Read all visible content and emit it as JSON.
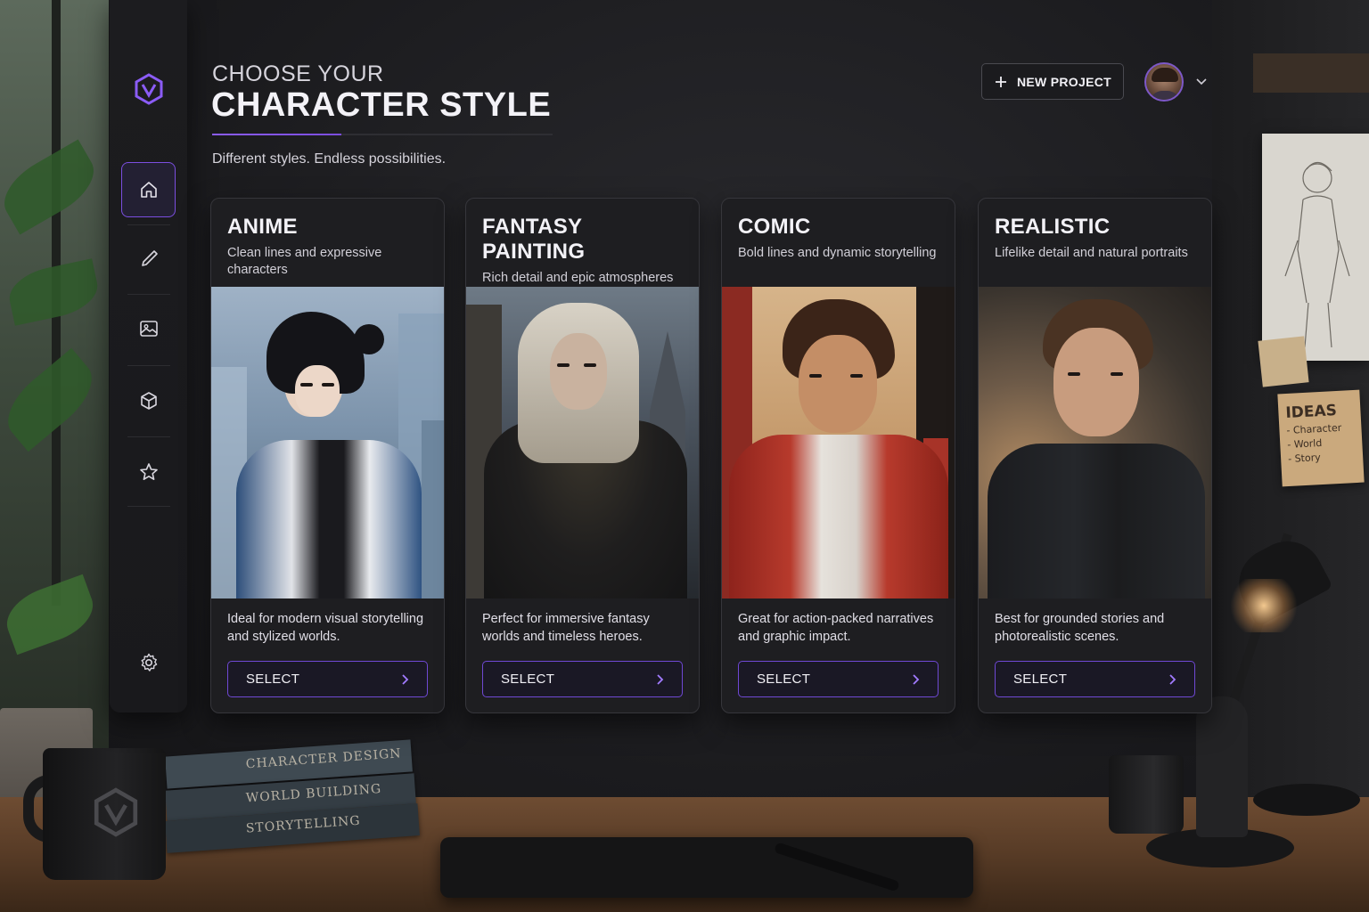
{
  "header": {
    "eyebrow": "CHOOSE YOUR",
    "title": "CHARACTER STYLE",
    "subtitle": "Different styles. Endless possibilities.",
    "new_project_label": "NEW PROJECT"
  },
  "sidebar": {
    "items": [
      {
        "name": "home",
        "icon": "home-icon",
        "active": true
      },
      {
        "name": "brush",
        "icon": "brush-icon",
        "active": false
      },
      {
        "name": "gallery",
        "icon": "image-icon",
        "active": false
      },
      {
        "name": "models",
        "icon": "cube-icon",
        "active": false
      },
      {
        "name": "favorites",
        "icon": "star-icon",
        "active": false
      }
    ],
    "settings_icon": "gear-icon"
  },
  "cards": [
    {
      "title": "ANIME",
      "tagline": "Clean lines and expressive characters",
      "description": "Ideal for modern visual storytelling and stylized worlds.",
      "button": "SELECT"
    },
    {
      "title": "FANTASY PAINTING",
      "tagline": "Rich detail and epic atmospheres",
      "description": "Perfect for immersive fantasy worlds and timeless heroes.",
      "button": "SELECT"
    },
    {
      "title": "COMIC",
      "tagline": "Bold lines and dynamic storytelling",
      "description": "Great for action-packed narratives and graphic impact.",
      "button": "SELECT"
    },
    {
      "title": "REALISTIC",
      "tagline": "Lifelike detail and natural portraits",
      "description": "Best for grounded stories and photorealistic scenes.",
      "button": "SELECT"
    }
  ],
  "room": {
    "books": [
      "CHARACTER DESIGN",
      "WORLD BUILDING",
      "STORYTELLING"
    ],
    "ideas_note": {
      "title": "IDEAS",
      "items": [
        "- Character",
        "- World",
        "- Story"
      ]
    }
  },
  "colors": {
    "accent": "#7c4ddd",
    "background": "#1b1b1e",
    "card": "#1e1e21",
    "text": "#f3f2f7"
  }
}
